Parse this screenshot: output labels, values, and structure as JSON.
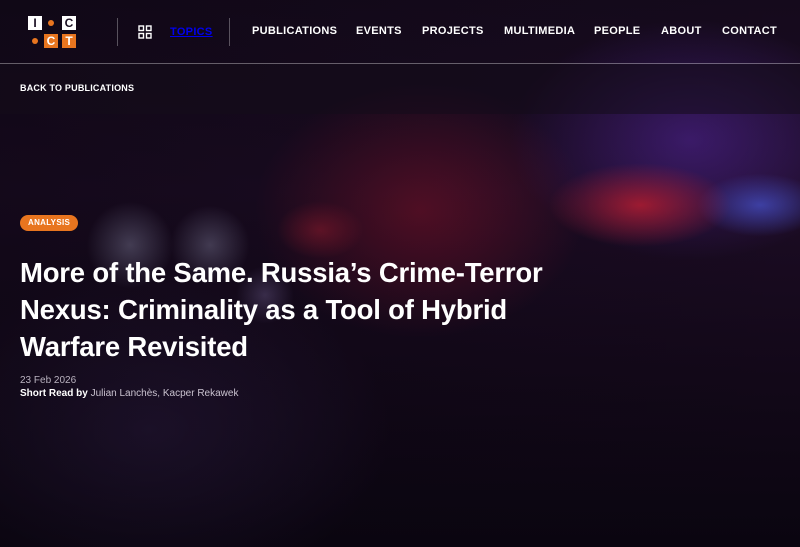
{
  "logo": {
    "letters": [
      "I",
      "C",
      "C",
      "T"
    ],
    "accent_color": "#e8751f"
  },
  "nav": {
    "topics_label": "TOPICS",
    "topics_icon": "grid-icon",
    "items": [
      {
        "label": "PUBLICATIONS"
      },
      {
        "label": "EVENTS"
      },
      {
        "label": "PROJECTS"
      },
      {
        "label": "MULTIMEDIA"
      },
      {
        "label": "PEOPLE"
      },
      {
        "label": "ABOUT"
      },
      {
        "label": "CONTACT"
      }
    ]
  },
  "subbar": {
    "back_label": "BACK TO PUBLICATIONS"
  },
  "article": {
    "badge": "ANALYSIS",
    "title": "More of the Same. Russia’s Crime-Terror Nexus: Criminality as a Tool of Hybrid Warfare Revisited",
    "date": "23 Feb 2026",
    "type": "Short Read",
    "by": "by",
    "authors": [
      "Julian Lanchès",
      "Kacper Rekawek"
    ],
    "author_separator": ", "
  },
  "colors": {
    "accent": "#e8751f",
    "text": "#ffffff",
    "muted": "#b9b2bf"
  }
}
